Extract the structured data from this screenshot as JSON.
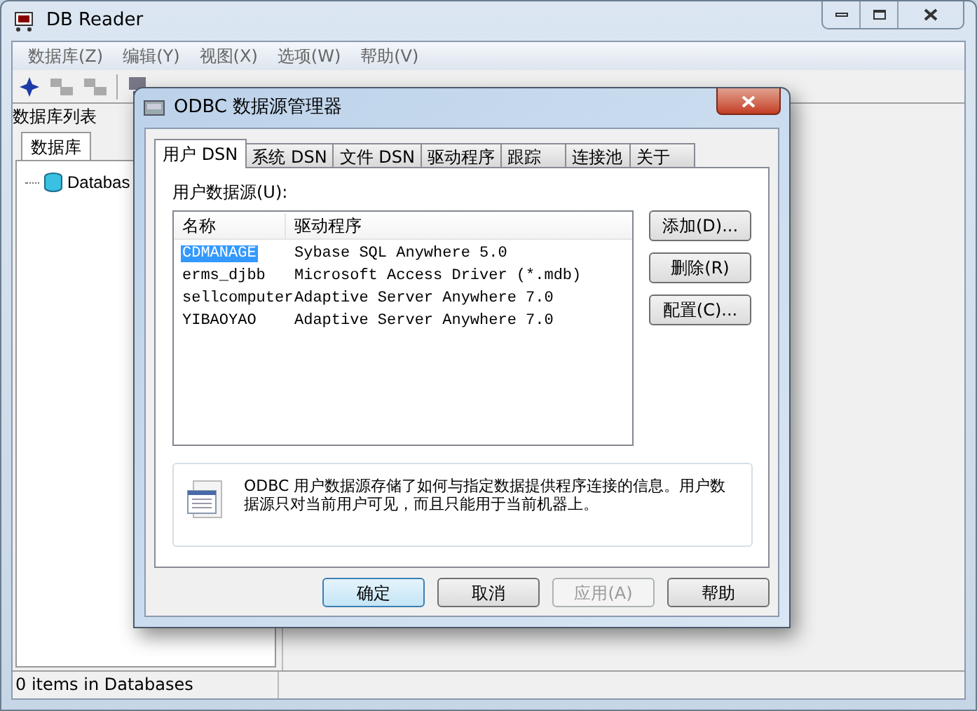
{
  "main_window": {
    "title": "DB Reader",
    "menu": [
      "数据库(Z)",
      "编辑(Y)",
      "视图(X)",
      "选项(W)",
      "帮助(V)"
    ],
    "panel_title": "数据库列表",
    "panel_tabs": [
      {
        "label": "数据库",
        "selected": true
      }
    ],
    "tree": [
      {
        "label": "Databas"
      }
    ],
    "status_bar": [
      "0 items in Databases"
    ]
  },
  "dialog": {
    "title": "ODBC 数据源管理器",
    "tabs": [
      {
        "label": "用户 DSN",
        "selected": true
      },
      {
        "label": "系统 DSN",
        "selected": false
      },
      {
        "label": "文件 DSN",
        "selected": false
      },
      {
        "label": "驱动程序",
        "selected": false
      },
      {
        "label": "跟踪",
        "selected": false
      },
      {
        "label": "连接池",
        "selected": false
      },
      {
        "label": "关于",
        "selected": false
      }
    ],
    "list_label": "用户数据源(U):",
    "columns": [
      "名称",
      "驱动程序"
    ],
    "rows": [
      {
        "name": "CDMANAGE",
        "driver": "Sybase SQL Anywhere 5.0",
        "selected": true
      },
      {
        "name": "erms_djbb",
        "driver": "Microsoft Access Driver (*.mdb)",
        "selected": false
      },
      {
        "name": "sellcomputer",
        "driver": "Adaptive Server Anywhere 7.0",
        "selected": false
      },
      {
        "name": "YIBAOYAO",
        "driver": "Adaptive Server Anywhere 7.0",
        "selected": false
      }
    ],
    "side_buttons": [
      "添加(D)...",
      "删除(R)",
      "配置(C)..."
    ],
    "info": "ODBC 用户数据源存储了如何与指定数据提供程序连接的信息。用户数据源只对当前用户可见，而且只能用于当前机器上。",
    "buttons": [
      {
        "label": "确定",
        "default": true,
        "disabled": false
      },
      {
        "label": "取消",
        "default": false,
        "disabled": false
      },
      {
        "label": "应用(A)",
        "default": false,
        "disabled": true
      },
      {
        "label": "帮助",
        "default": false,
        "disabled": false
      }
    ]
  }
}
